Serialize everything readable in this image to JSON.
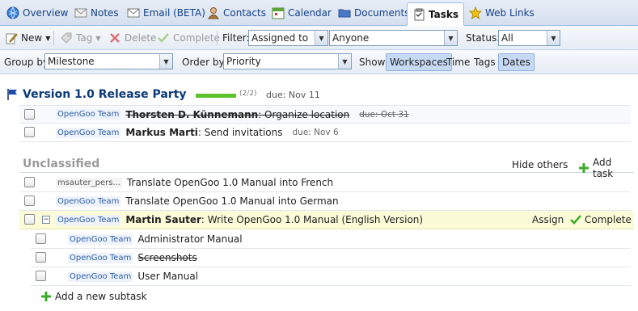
{
  "tabs": [
    {
      "label": "Overview",
      "icon": "globe-icon"
    },
    {
      "label": "Notes",
      "icon": "note-icon"
    },
    {
      "label": "Email (BETA)",
      "icon": "email-icon"
    },
    {
      "label": "Contacts",
      "icon": "contacts-icon"
    },
    {
      "label": "Calendar",
      "icon": "calendar-icon"
    },
    {
      "label": "Documents",
      "icon": "documents-icon"
    },
    {
      "label": "Tasks",
      "icon": "tasks-icon",
      "active": true
    },
    {
      "label": "Web Links",
      "icon": "star-icon"
    }
  ],
  "toolbar1": {
    "new_label": "New",
    "tag_label": "Tag",
    "delete_label": "Delete",
    "complete_label": "Complete",
    "filter_label": "Filter:",
    "filter_value": "Assigned to",
    "assignee_value": "Anyone",
    "status_label": "Status:",
    "status_value": "All"
  },
  "toolbar2": {
    "groupby_label": "Group by:",
    "groupby_value": "Milestone",
    "orderby_label": "Order by:",
    "orderby_value": "Priority",
    "show_label": "Show:",
    "show_workspaces": "Workspaces",
    "show_time": "Time",
    "show_tags": "Tags",
    "show_dates": "Dates"
  },
  "milestone": {
    "title": "Version 1.0 Release Party",
    "progress_text": "(2/2)",
    "progress_fraction": 1.0,
    "due": "due: Nov 11",
    "tasks": [
      {
        "workspace": "OpenGoo Team",
        "assignee": "Thorsten D. Künnemann",
        "title": ": Organize location",
        "due": "due: Oct 31",
        "completed": true
      },
      {
        "workspace": "OpenGoo Team",
        "assignee": "Markus Marti",
        "title": ": Send invitations",
        "due": "due: Nov 6",
        "completed": false
      }
    ]
  },
  "unclassified": {
    "title": "Unclassified",
    "hide_others": "Hide others",
    "add_task": "Add task",
    "tasks": [
      {
        "workspace": "msauter_pers...",
        "title": "Translate OpenGoo 1.0 Manual into French"
      },
      {
        "workspace": "OpenGoo Team",
        "title": "Translate OpenGoo 1.0 Manual into German"
      }
    ],
    "expanded_task": {
      "workspace": "OpenGoo Team",
      "assignee": "Martin Sauter",
      "title": ": Write OpenGoo 1.0 Manual (English Version)",
      "assign_label": "Assign",
      "complete_label": "Complete",
      "subtasks": [
        {
          "workspace": "OpenGoo Team",
          "title": "Administrator Manual",
          "completed": false
        },
        {
          "workspace": "OpenGoo Team",
          "title": "Screenshots",
          "completed": true
        },
        {
          "workspace": "OpenGoo Team",
          "title": "User Manual",
          "completed": false
        }
      ],
      "add_subtask": "Add a new subtask"
    }
  },
  "colors": {
    "accent": "#15428b",
    "progress": "#5cc22a",
    "highlight_row": "#fbfbd8"
  }
}
